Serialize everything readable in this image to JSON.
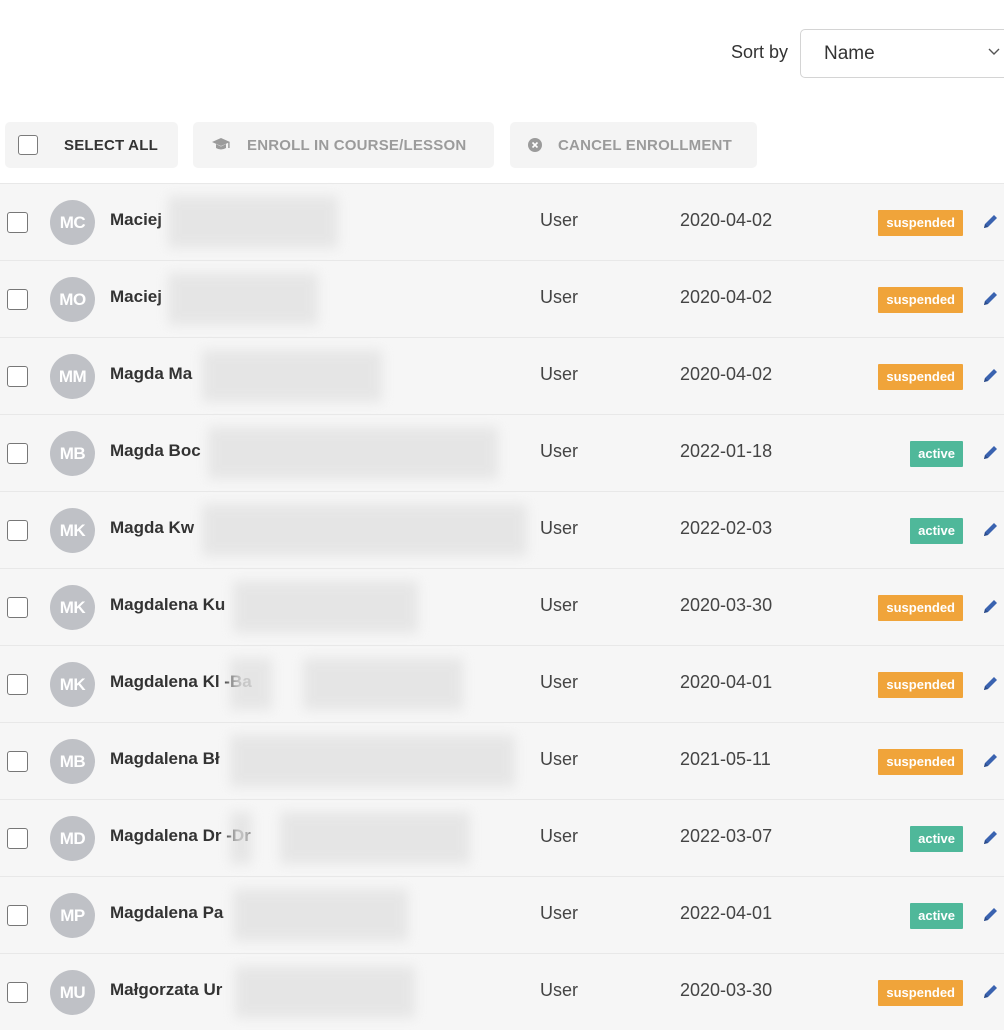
{
  "sort": {
    "label": "Sort by",
    "value": "Name"
  },
  "toolbar": {
    "select_all": "SELECT ALL",
    "enroll": "ENROLL IN COURSE/LESSON",
    "cancel": "CANCEL ENROLLMENT"
  },
  "colors": {
    "suspended": "#f0a43a",
    "active": "#4fb89a",
    "avatar": "#bfc1c6",
    "edit": "#3a63b0"
  },
  "rows": [
    {
      "initials": "MC",
      "name": "Maciej",
      "role": "User",
      "date": "2020-04-02",
      "status": "suspended"
    },
    {
      "initials": "MO",
      "name": "Maciej",
      "role": "User",
      "date": "2020-04-02",
      "status": "suspended"
    },
    {
      "initials": "MM",
      "name": "Magda Ma",
      "role": "User",
      "date": "2020-04-02",
      "status": "suspended"
    },
    {
      "initials": "MB",
      "name": "Magda Boc",
      "role": "User",
      "date": "2022-01-18",
      "status": "active"
    },
    {
      "initials": "MK",
      "name": "Magda Kw",
      "role": "User",
      "date": "2022-02-03",
      "status": "active"
    },
    {
      "initials": "MK",
      "name": "Magdalena Ku",
      "role": "User",
      "date": "2020-03-30",
      "status": "suspended"
    },
    {
      "initials": "MK",
      "name": "Magdalena Kl -Ba",
      "role": "User",
      "date": "2020-04-01",
      "status": "suspended"
    },
    {
      "initials": "MB",
      "name": "Magdalena Bł",
      "role": "User",
      "date": "2021-05-11",
      "status": "suspended"
    },
    {
      "initials": "MD",
      "name": "Magdalena Dr -Dr",
      "role": "User",
      "date": "2022-03-07",
      "status": "active"
    },
    {
      "initials": "MP",
      "name": "Magdalena Pa",
      "role": "User",
      "date": "2022-04-01",
      "status": "active"
    },
    {
      "initials": "MU",
      "name": "Małgorzata Ur",
      "role": "User",
      "date": "2020-03-30",
      "status": "suspended"
    }
  ]
}
